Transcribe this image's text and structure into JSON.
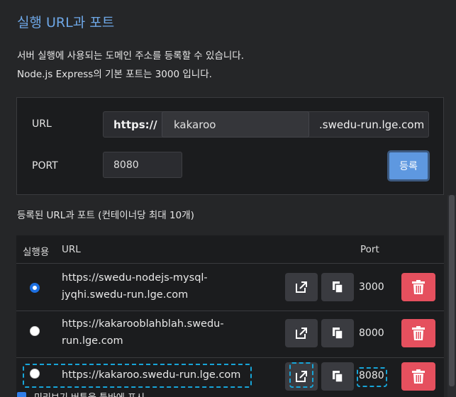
{
  "section_title": "실행 URL과 포트",
  "description": {
    "line1": "서버 실행에 사용되는 도메인 주소를 등록할 수 있습니다.",
    "line2": "Node.js Express의 기본 포트는 3000 입니다."
  },
  "form": {
    "url_label": "URL",
    "url_prefix": "https://",
    "url_value": "kakaroo",
    "url_suffix": ".swedu-run.lge.com",
    "port_label": "PORT",
    "port_value": "8080",
    "register_label": "등록"
  },
  "list": {
    "title": "등록된 URL과 포트 (컨테이너당 최대 10개)",
    "columns": {
      "run": "실행용",
      "url": "URL",
      "port": "Port"
    },
    "rows": [
      {
        "url_line1": "https://swedu-nodejs-mysql-",
        "url_line2": "jyqhi.swedu-run.lge.com",
        "port": "3000",
        "selected": true
      },
      {
        "url_line1": "https://kakarooblahblah.swedu-",
        "url_line2": "run.lge.com",
        "port": "8000",
        "selected": false
      },
      {
        "url_line1": "https://kakaroo.swedu-run.lge.com",
        "url_line2": "",
        "port": "8080",
        "selected": false
      }
    ]
  },
  "bottom_option": {
    "label": "미리보기 버튼을 툴바에 표시",
    "checked": true
  },
  "icons": [
    "open-external-icon",
    "copy-icon",
    "trash-icon"
  ],
  "colors": {
    "accent": "#6ea7e6",
    "primary_button": "#5e98e0",
    "danger": "#e5505e",
    "highlight": "#17a5d8"
  }
}
